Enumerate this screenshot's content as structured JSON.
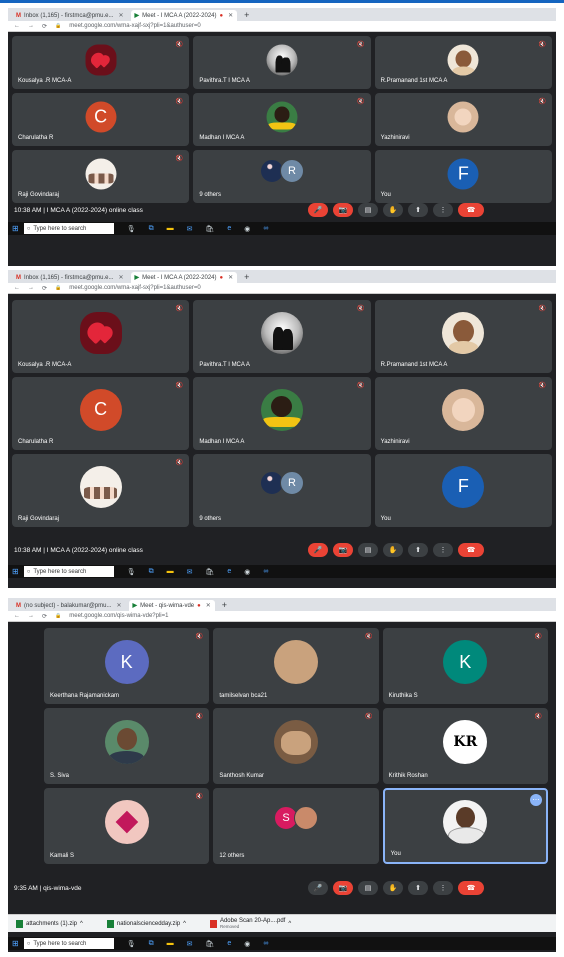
{
  "screens": [
    {
      "tabs": [
        "Inbox (1,165) - firstmca@pmu.e...",
        "Meet - I MCA A (2022-2024)"
      ],
      "url": "meet.google.com/wma-xajf-sxj?pli=1&authuser=0",
      "participants": [
        {
          "name": "Kousalya .R MCA-A",
          "avatar": "hearts"
        },
        {
          "name": "Pavithra.T I MCA A",
          "avatar": "couple"
        },
        {
          "name": "R.Pramanand 1st MCA A",
          "avatar": "face"
        },
        {
          "name": "Charulatha R",
          "avatar": "letter-c",
          "letter": "C"
        },
        {
          "name": "Madhan I MCA A",
          "avatar": "runner"
        },
        {
          "name": "Yazhiniravi",
          "avatar": "baby"
        },
        {
          "name": "Raji Govindaraj",
          "avatar": "group"
        },
        {
          "name": "9 others",
          "others": true,
          "letter": "R"
        },
        {
          "name": "You",
          "avatar": "letter-f",
          "letter": "F"
        }
      ],
      "meeting": "10:38 AM  |  I MCA A (2022-2024) online class",
      "taskbar_search": "Type here to search"
    },
    {
      "tabs": [
        "Inbox (1,165) - firstmca@pmu.e...",
        "Meet - I MCA A (2022-2024)"
      ],
      "url": "meet.google.com/wma-xajf-sxj?pli=1&authuser=0",
      "participants": [
        {
          "name": "Kousalya .R MCA-A",
          "avatar": "hearts"
        },
        {
          "name": "Pavithra.T I MCA A",
          "avatar": "couple"
        },
        {
          "name": "R.Pramanand 1st MCA A",
          "avatar": "face"
        },
        {
          "name": "Charulatha R",
          "avatar": "letter-c",
          "letter": "C"
        },
        {
          "name": "Madhan I MCA A",
          "avatar": "runner"
        },
        {
          "name": "Yazhiniravi",
          "avatar": "baby"
        },
        {
          "name": "Raji Govindaraj",
          "avatar": "group"
        },
        {
          "name": "9 others",
          "others": true,
          "letter": "R"
        },
        {
          "name": "You",
          "avatar": "letter-f",
          "letter": "F"
        }
      ],
      "meeting": "10:38 AM  |  I MCA A (2022-2024) online class",
      "taskbar_search": "Type here to search"
    },
    {
      "tabs": [
        "(no subject) - balakumar@pmu...",
        "Meet - qis-wima-vde"
      ],
      "url": "meet.google.com/qis-wima-vde?pli=1",
      "participants": [
        {
          "name": "Keerthana Rajamanickam",
          "avatar": "letter-k1",
          "letter": "K"
        },
        {
          "name": "tamilselvan bca21",
          "avatar": "photo"
        },
        {
          "name": "Kiruthika S",
          "avatar": "letter-k2",
          "letter": "K"
        },
        {
          "name": "S. Siva",
          "avatar": "man"
        },
        {
          "name": "Santhosh Kumar",
          "avatar": "crowd"
        },
        {
          "name": "Krithik Roshan",
          "avatar": "kr",
          "letter": "KR"
        },
        {
          "name": "Kamali S",
          "avatar": "hand"
        },
        {
          "name": "12 others",
          "others": true,
          "letter": "S"
        },
        {
          "name": "You",
          "avatar": "you",
          "self": true
        }
      ],
      "meeting": "9:35 AM  |  qis-wima-vde",
      "downloads": [
        {
          "name": "attachments (1).zip"
        },
        {
          "name": "nationalsciencedday.zip"
        },
        {
          "name": "Adobe Scan 20-Ap....pdf",
          "sub": "Removed"
        }
      ],
      "taskbar_search": "Type here to search"
    }
  ],
  "colors": {
    "accent": "#1565c0",
    "tile": "#3c4043",
    "end_call": "#ea4335"
  }
}
